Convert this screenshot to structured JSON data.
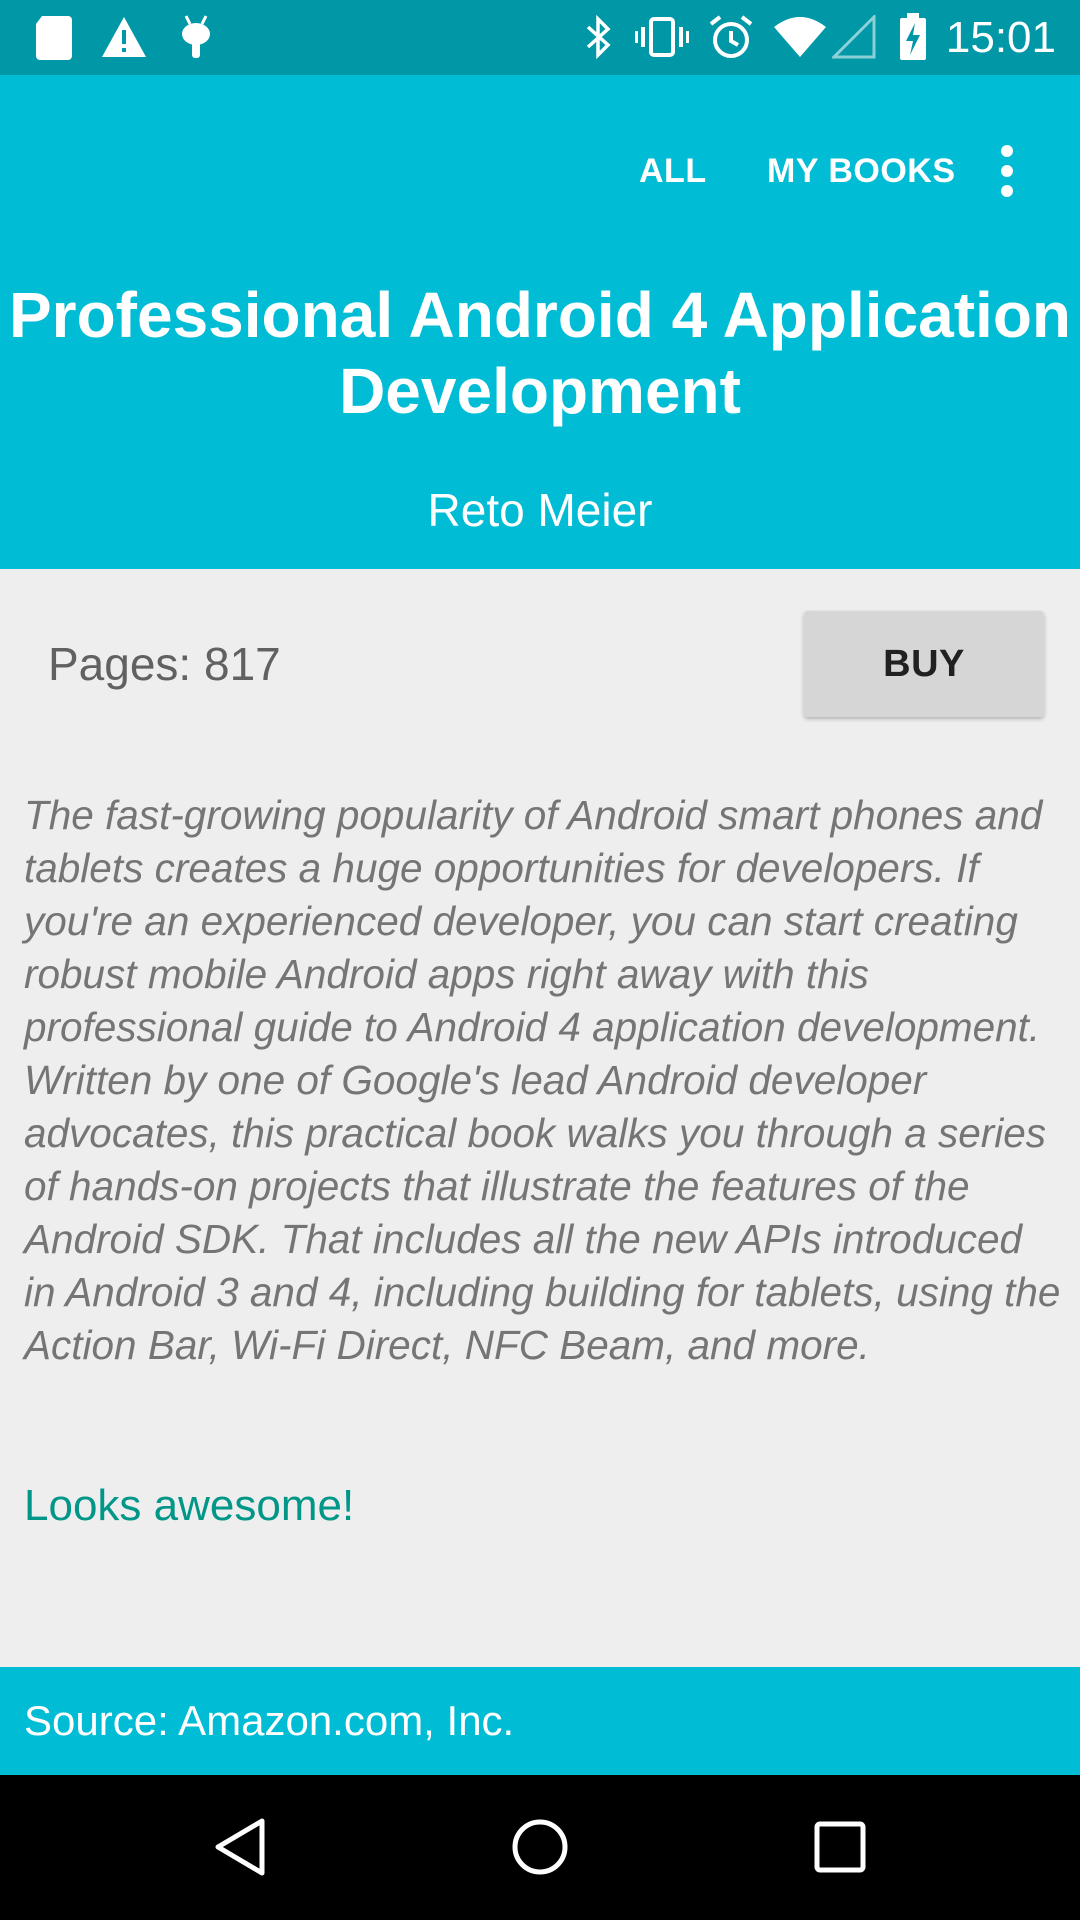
{
  "status_bar": {
    "time": "15:01",
    "left_icons": [
      "sd-card-icon",
      "warning-icon",
      "android-debug-icon"
    ],
    "right_icons": [
      "bluetooth-icon",
      "vibrate-icon",
      "alarm-icon",
      "wifi-icon",
      "cell-signal-icon",
      "battery-charging-icon"
    ]
  },
  "appbar": {
    "tabs": [
      {
        "label": "ALL"
      },
      {
        "label": "MY BOOKS"
      }
    ],
    "overflow_icon": "more-vert-icon"
  },
  "book": {
    "title": "Professional Android 4 Application Development",
    "author": "Reto Meier",
    "pages": "Pages: 817",
    "buy_label": "BUY",
    "description": "The fast-growing popularity of Android smart phones and tablets creates a huge opportunities for developers. If you're an experienced developer, you can start creating robust mobile Android apps right away with this professional guide to Android 4 application development. Written by one of Google's lead Android developer advocates, this practical book walks you through a series of hands-on projects that illustrate the features of the Android SDK. That includes all the new APIs introduced in Android 3 and 4, including building for tablets, using the Action Bar, Wi-Fi Direct, NFC Beam, and more.",
    "review": "Looks awesome!"
  },
  "footer": {
    "source": "Source: Amazon.com, Inc."
  },
  "nav_bar": [
    "back-icon",
    "home-icon",
    "recents-icon"
  ],
  "colors": {
    "primary": "#00bcd4",
    "primary_dark": "#0097a7",
    "accent": "#009688",
    "background": "#eeeeee"
  }
}
